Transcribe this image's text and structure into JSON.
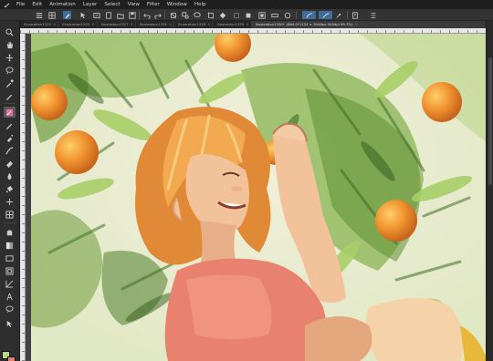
{
  "menu": {
    "app_icon": "clip-studio-icon",
    "items": [
      "File",
      "Edit",
      "Animation",
      "Layer",
      "Select",
      "View",
      "Filter",
      "Window",
      "Help"
    ]
  },
  "command_bar": {
    "icons": [
      "menu-icon",
      "grid-icon",
      "pen-icon",
      "select-tool-icon",
      "layer-property-icon",
      "new-canvas-icon",
      "open-icon",
      "save-icon",
      "undo-icon",
      "redo-icon",
      "clear-icon",
      "shapes-icon",
      "lasso-icon",
      "crop-icon",
      "fill-icon",
      "transform-icon",
      "clear-out-icon",
      "stroke-icon",
      "ruler-icon",
      "color-icon",
      "draw-icon",
      "vector-icon",
      "export-icon",
      "book-icon",
      "settings-icon"
    ]
  },
  "tabs": [
    {
      "label": "Illustration1324",
      "active": false
    },
    {
      "label": "Illustration1325",
      "active": false
    },
    {
      "label": "Illustration1327",
      "active": false
    },
    {
      "label": "Illustration1326",
      "active": false
    },
    {
      "label": "Illustration1328",
      "active": false
    },
    {
      "label": "Illustration1329",
      "active": false
    },
    {
      "label": "Illustration1330*",
      "active": true,
      "info": "(864.0*1124 × 3048px 500dpi 99.7%)"
    }
  ],
  "tools": [
    "zoom-icon",
    "hand-icon",
    "rotate-icon",
    "move-icon",
    "lasso-icon",
    "eyedropper-icon",
    "pen-icon",
    "brush-icon",
    "pencil-icon",
    "airbrush-icon",
    "decoration-icon",
    "eraser-icon",
    "blend-icon",
    "fill-icon",
    "gradient-icon",
    "figure-icon",
    "frame-icon",
    "text-icon",
    "balloon-icon",
    "correct-line-icon",
    "operation-icon"
  ],
  "colors": {
    "main_color": "#b6d58a",
    "sub_color": "#e8836a",
    "accent": "#3f6d98"
  },
  "canvas": {
    "description_icon": "illustration-artwork"
  }
}
